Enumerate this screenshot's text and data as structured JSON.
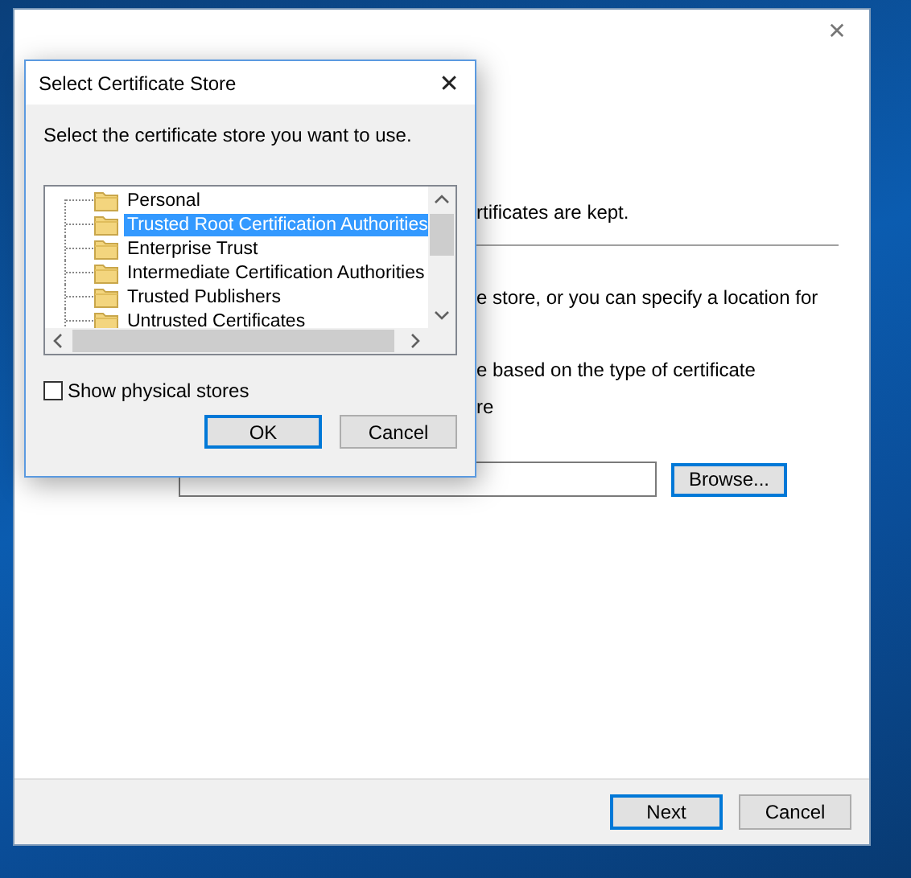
{
  "wizard": {
    "close_glyph": "✕",
    "texts": [
      {
        "kind": "line",
        "text": "rtificates are kept."
      },
      {
        "kind": "divider"
      },
      {
        "kind": "line",
        "text": "e store, or you can specify a location for"
      },
      {
        "kind": "line",
        "text": "e based on the type of certificate"
      },
      {
        "kind": "line",
        "text": "re"
      }
    ],
    "browse_button": {
      "label": "Browse...",
      "default": true
    },
    "buttons": [
      {
        "label": "Next",
        "default": true
      },
      {
        "label": "Cancel",
        "default": false
      }
    ]
  },
  "dialog": {
    "title": "Select Certificate Store",
    "close_glyph": "✕",
    "instruction": "Select the certificate store you want to use.",
    "stores": [
      {
        "label": "Personal",
        "selected": false
      },
      {
        "label": "Trusted Root Certification Authorities",
        "selected": true
      },
      {
        "label": "Enterprise Trust",
        "selected": false
      },
      {
        "label": "Intermediate Certification Authorities",
        "selected": false
      },
      {
        "label": "Trusted Publishers",
        "selected": false
      },
      {
        "label": "Untrusted Certificates",
        "selected": false
      }
    ],
    "show_physical_stores": {
      "label": "Show physical stores",
      "checked": false
    },
    "buttons": [
      {
        "label": "OK",
        "default": true
      },
      {
        "label": "Cancel",
        "default": false
      }
    ]
  }
}
